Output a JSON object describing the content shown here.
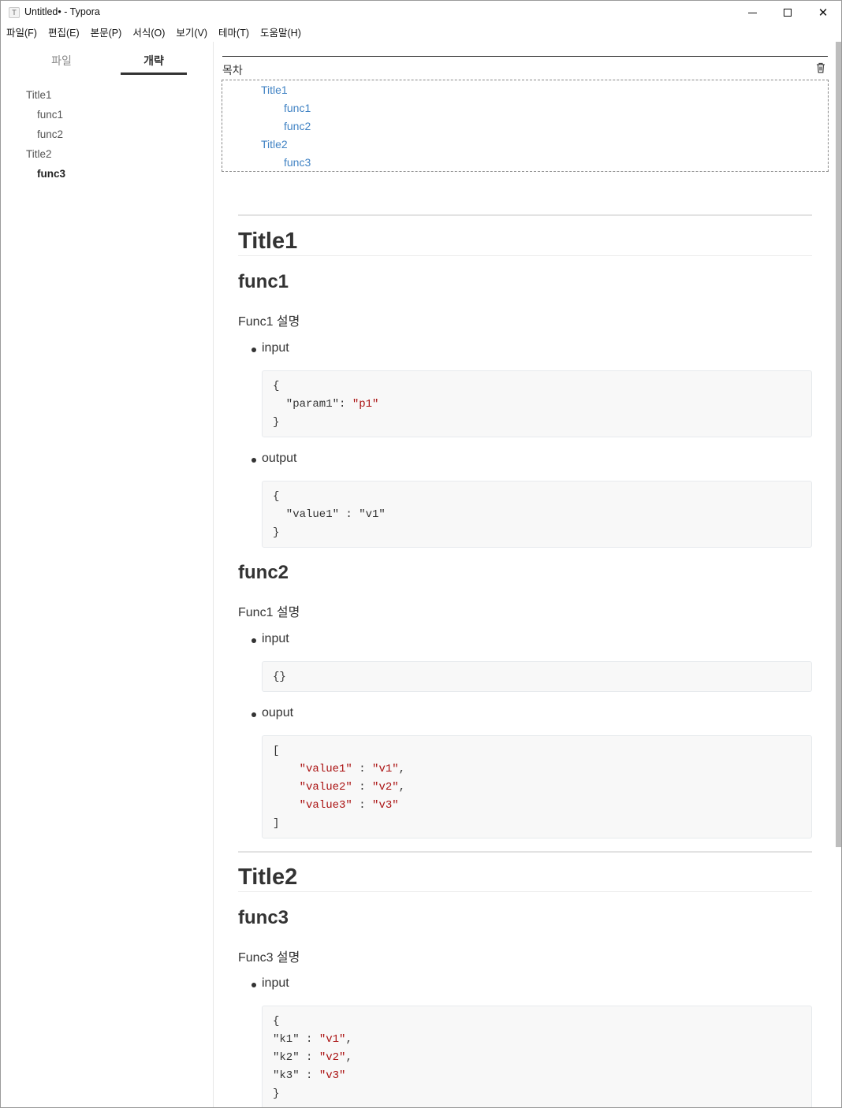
{
  "window": {
    "icon_glyph": "T",
    "title": "Untitled• - Typora",
    "minimize_icon": "minimize-icon",
    "maximize_icon": "maximize-icon",
    "close_icon": "close-icon",
    "close_glyph": "✕"
  },
  "menu": [
    "파일(F)",
    "편집(E)",
    "본문(P)",
    "서식(O)",
    "보기(V)",
    "테마(T)",
    "도움말(H)"
  ],
  "sidebar": {
    "tabs": {
      "files": "파일",
      "outline": "개략"
    },
    "active_tab": "outline",
    "outline": [
      {
        "label": "Title1",
        "level": 1
      },
      {
        "label": "func1",
        "level": 2
      },
      {
        "label": "func2",
        "level": 2
      },
      {
        "label": "Title2",
        "level": 1
      },
      {
        "label": "func3",
        "level": 2,
        "active": true
      }
    ]
  },
  "toc": {
    "label": "목차",
    "delete_icon": "trash-icon",
    "items": [
      "Title1",
      "func1",
      "func2",
      "Title2",
      "func3"
    ]
  },
  "doc": {
    "title1": "Title1",
    "func1": {
      "heading": "func1",
      "desc": "Func1 설명",
      "input_label": "input",
      "input_code": {
        "l1": "{",
        "key": "  \"param1\"",
        "sep": ": ",
        "val": "\"p1\"",
        "l3": "}"
      },
      "output_label": "output",
      "output_code": {
        "l1": "{",
        "l2": "  \"value1\" : \"v1\"",
        "l3": "}"
      }
    },
    "func2": {
      "heading": "func2",
      "desc": "Func1 설명",
      "input_label": "input",
      "input_code": "{}",
      "output_label": "ouput",
      "output_code": {
        "open": "[",
        "rows": [
          {
            "indent": "    ",
            "key": "\"value1\"",
            "sep": " : ",
            "val": "\"v1\"",
            "end": ","
          },
          {
            "indent": "    ",
            "key": "\"value2\"",
            "sep": " : ",
            "val": "\"v2\"",
            "end": ","
          },
          {
            "indent": "    ",
            "key": "\"value3\"",
            "sep": " : ",
            "val": "\"v3\"",
            "end": ""
          }
        ],
        "close": "]"
      }
    },
    "title2": "Title2",
    "func3": {
      "heading": "func3",
      "desc": "Func3 설명",
      "input_label": "input",
      "input_code": {
        "open": "{",
        "rows": [
          {
            "key": "\"k1\"",
            "sep": " : ",
            "val": "\"v1\"",
            "end": ","
          },
          {
            "key": "\"k2\"",
            "sep": " : ",
            "val": "\"v2\"",
            "end": ","
          },
          {
            "key": "\"k3\"",
            "sep": " : ",
            "val": "\"v3\"",
            "end": ""
          }
        ],
        "close": "}"
      }
    }
  },
  "colors": {
    "link": "#4183c4",
    "string": "#aa1111",
    "text": "#333333"
  }
}
